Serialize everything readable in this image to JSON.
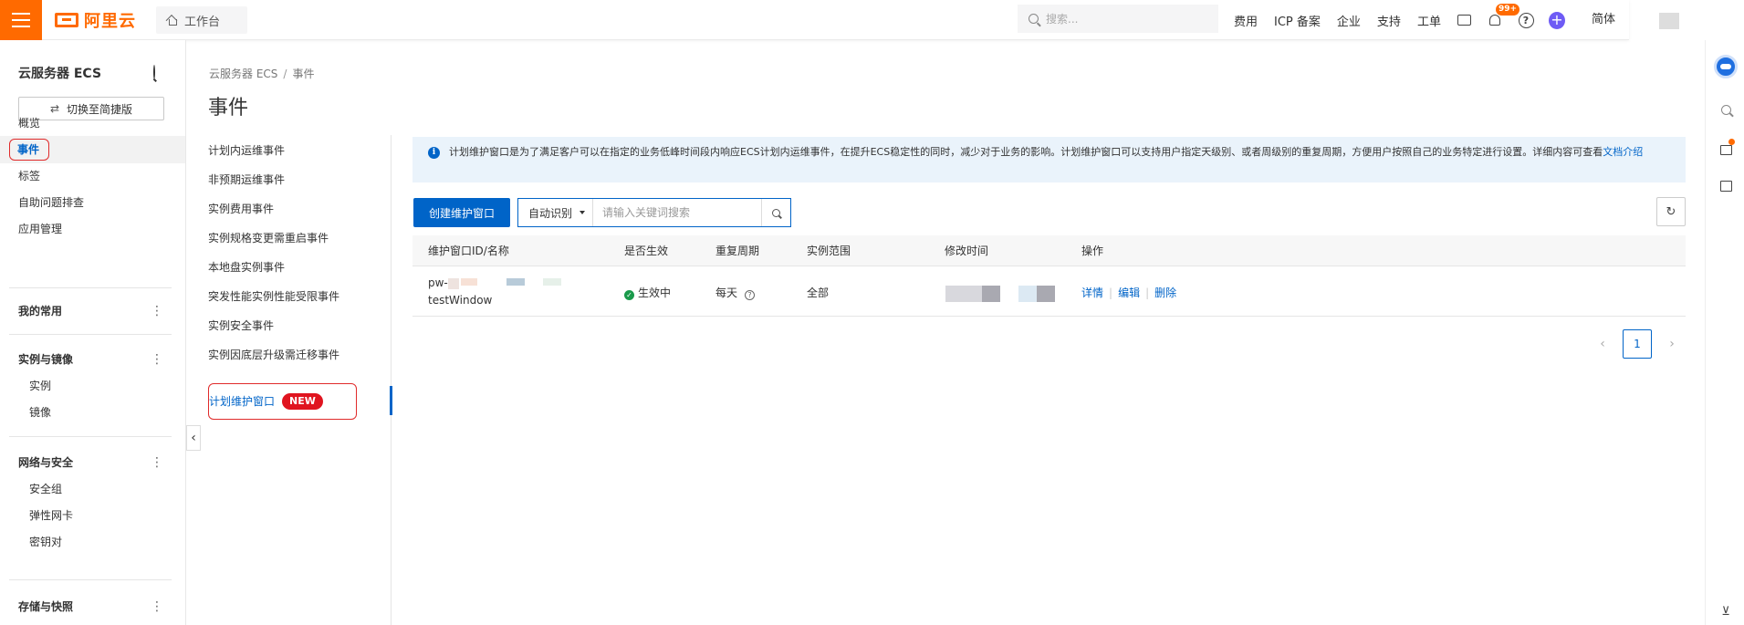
{
  "topbar": {
    "logo_text": "阿里云",
    "workbench_label": "工作台",
    "search_placeholder": "搜索...",
    "nav": [
      "费用",
      "ICP 备案",
      "企业",
      "支持",
      "工单"
    ],
    "notif_badge": "99+",
    "help_glyph": "?",
    "lang": "简体",
    "brand_color": "#ff6a00"
  },
  "sidebar": {
    "title": "云服务器 ECS",
    "switch_label": "切换至简捷版",
    "items": [
      "概览",
      "事件",
      "标签",
      "自助问题排查",
      "应用管理"
    ],
    "active_item": "事件",
    "groups": [
      {
        "label": "我的常用",
        "subs": []
      },
      {
        "label": "实例与镜像",
        "subs": [
          "实例",
          "镜像"
        ]
      },
      {
        "label": "网络与安全",
        "subs": [
          "安全组",
          "弹性网卡",
          "密钥对"
        ]
      },
      {
        "label": "存储与快照",
        "subs": []
      }
    ]
  },
  "breadcrumb": [
    "云服务器 ECS",
    "事件"
  ],
  "page_title": "事件",
  "subnav": {
    "items": [
      "计划内运维事件",
      "非预期运维事件",
      "实例费用事件",
      "实例规格变更需重启事件",
      "本地盘实例事件",
      "突发性能实例性能受限事件",
      "实例安全事件",
      "实例因底层升级需迁移事件"
    ],
    "active": "计划维护窗口",
    "badge": "NEW"
  },
  "notice": {
    "text": "计划维护窗口是为了满足客户可以在指定的业务低峰时间段内响应ECS计划内运维事件，在提升ECS稳定性的同时，减少对于业务的影响。计划维护窗口可以支持用户指定天级别、或者周级别的重复周期，方便用户按照自己的业务特定进行设置。详细内容可查看",
    "link": "文档介绍"
  },
  "toolbar": {
    "create_label": "创建维护窗口",
    "select_label": "自动识别",
    "search_placeholder": "请输入关键词搜索"
  },
  "table": {
    "headers": [
      "维护窗口ID/名称",
      "是否生效",
      "重复周期",
      "实例范围",
      "修改时间",
      "操作"
    ],
    "rows": [
      {
        "id_prefix": "pw-",
        "name": "testWindow",
        "status": "生效中",
        "period": "每天",
        "scope": "全部",
        "actions": [
          "详情",
          "编辑",
          "删除"
        ]
      }
    ]
  },
  "pagination": {
    "current": "1"
  },
  "accent_color": "#0064c8",
  "status_color": "#1a9a4b",
  "highlight_color": "#e02b2b"
}
